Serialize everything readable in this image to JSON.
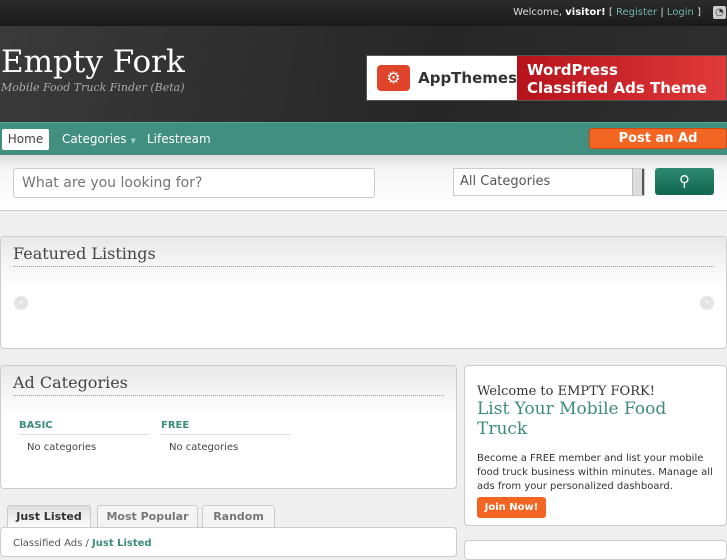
{
  "topbar": {
    "welcome": "Welcome,",
    "user": "visitor!",
    "open": "[",
    "register": "Register",
    "sep": "|",
    "login": "Login",
    "close": "]"
  },
  "header": {
    "title": "Empty Fork",
    "tagline": "Mobile Food Truck Finder (Beta)"
  },
  "banner": {
    "brand": "AppThemes",
    "line1": "WordPress",
    "line2": "Classified Ads Theme"
  },
  "nav": {
    "items": [
      {
        "label": "Home"
      },
      {
        "label": "Categories"
      },
      {
        "label": "Lifestream"
      }
    ],
    "post": "Post an Ad"
  },
  "search": {
    "placeholder": "What are you looking for?",
    "category": "All Categories"
  },
  "featured": {
    "title": "Featured Listings"
  },
  "adcats": {
    "title": "Ad Categories",
    "columns": [
      {
        "name": "BASIC",
        "empty": "No categories"
      },
      {
        "name": "FREE",
        "empty": "No categories"
      }
    ]
  },
  "welcome": {
    "title": "Welcome to EMPTY FORK!",
    "subtitle": "List Your Mobile Food Truck",
    "text": "Become a FREE member and list your mobile food truck business within minutes. Manage all ads from your personalized dashboard.",
    "join": "Join Now!"
  },
  "tabs": [
    {
      "label": "Just Listed"
    },
    {
      "label": "Most Popular"
    },
    {
      "label": "Random"
    }
  ],
  "crumb": {
    "root": "Classified Ads",
    "sep": "/",
    "current": "Just Listed"
  },
  "colors": {
    "accent": "#41907f",
    "orange": "#f26522"
  }
}
